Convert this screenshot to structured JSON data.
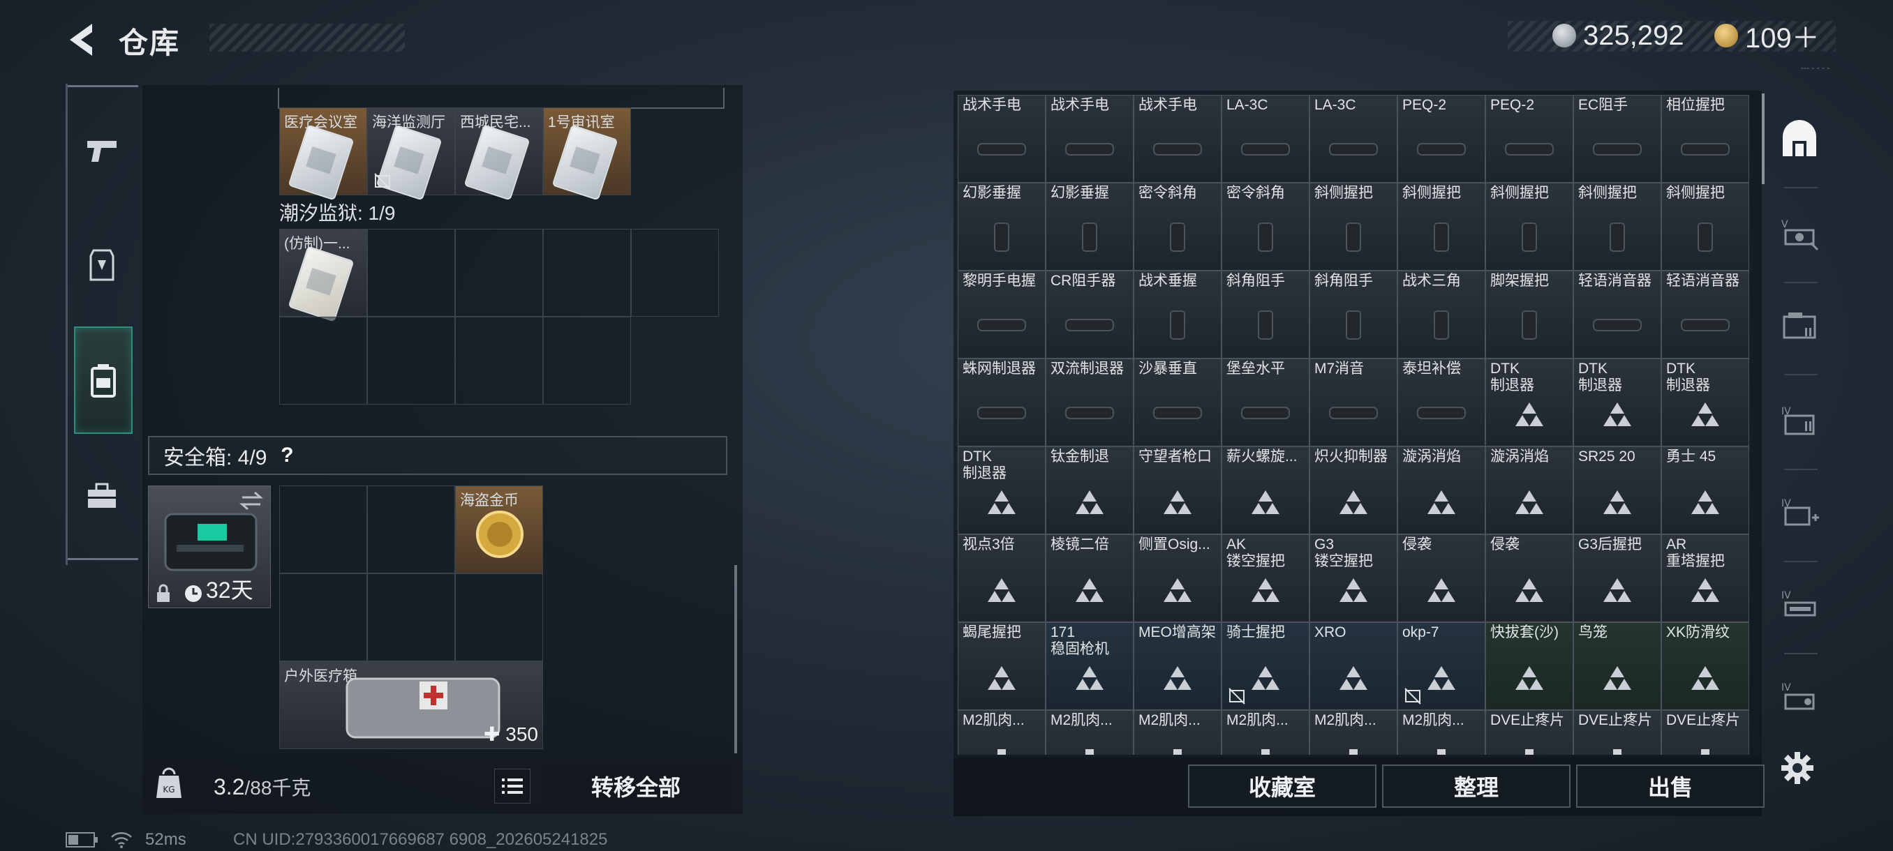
{
  "header": {
    "title": "仓库",
    "currency1": "325,292",
    "currency2": "109＋",
    "version": "--- - - - -"
  },
  "left_sidebar": [
    {
      "icon": "pistol-icon"
    },
    {
      "icon": "armor-icon"
    },
    {
      "icon": "backpack-icon"
    },
    {
      "icon": "toolbox-icon"
    }
  ],
  "keys_top": [
    "医疗会议室",
    "海洋监测厅",
    "西城民宅...",
    "1号审讯室"
  ],
  "tide_prison": {
    "label": "潮汐监狱: 1/9",
    "items": [
      "(仿制)一..."
    ]
  },
  "safe": {
    "label": "安全箱: 4/9",
    "help": "?",
    "time": "32天",
    "items": {
      "coin": "海盗金币",
      "medkit": "户外医疗箱",
      "medkit_value": "350"
    }
  },
  "footer_left": {
    "weight": "3.2",
    "weight_max": "/88千克",
    "transfer": "转移全部"
  },
  "grid": [
    [
      "战术手电",
      "战术手电",
      "战术手电",
      "LA-3C",
      "LA-3C",
      "PEQ-2",
      "PEQ-2",
      "EC阻手",
      "相位握把"
    ],
    [
      "幻影垂握",
      "幻影垂握",
      "密令斜角",
      "密令斜角",
      "斜侧握把",
      "斜侧握把",
      "斜侧握把",
      "斜侧握把",
      "斜侧握把"
    ],
    [
      "黎明手电握",
      "CR阻手器",
      "战术垂握",
      "斜角阻手",
      "斜角阻手",
      "战术三角",
      "脚架握把",
      "轻语消音器",
      "轻语消音器"
    ],
    [
      "蛛网制退器",
      "双流制退器",
      "沙暴垂直",
      "堡垒水平",
      "M7消音",
      "泰坦补偿",
      "DTK\n制退器",
      "DTK\n制退器",
      "DTK\n制退器"
    ],
    [
      "DTK\n制退器",
      "钛金制退",
      "守望者枪口",
      "薪火螺旋...",
      "炽火抑制器",
      "漩涡消焰",
      "漩涡消焰",
      "SR25 20",
      "勇士 45"
    ],
    [
      "视点3倍",
      "棱镜二倍",
      "侧置Osig...",
      "AK\n镂空握把",
      "G3\n镂空握把",
      "侵袭",
      "侵袭",
      "G3后握把",
      "AR\n重塔握把"
    ],
    [
      "蝎尾握把",
      "171\n稳固枪机",
      "MEO增高架",
      "骑士握把",
      "XRO",
      "okp-7",
      "快拔套(沙)",
      "鸟笼",
      "XK防滑纹"
    ],
    [
      "M2肌肉...",
      "M2肌肉...",
      "M2肌肉...",
      "M2肌肉...",
      "M2肌肉...",
      "M2肌肉...",
      "DVE止疼片",
      "DVE止疼片",
      "DVE止疼片"
    ]
  ],
  "footer_right": {
    "btn1": "收藏室",
    "btn2": "整理",
    "btn3": "出售"
  },
  "status": {
    "ping": "52ms",
    "uid": "CN UID:2793360017669687 6908_202605241825"
  },
  "colors": {
    "accent": "#2f8f7f",
    "cell_border": "#4a535c"
  }
}
